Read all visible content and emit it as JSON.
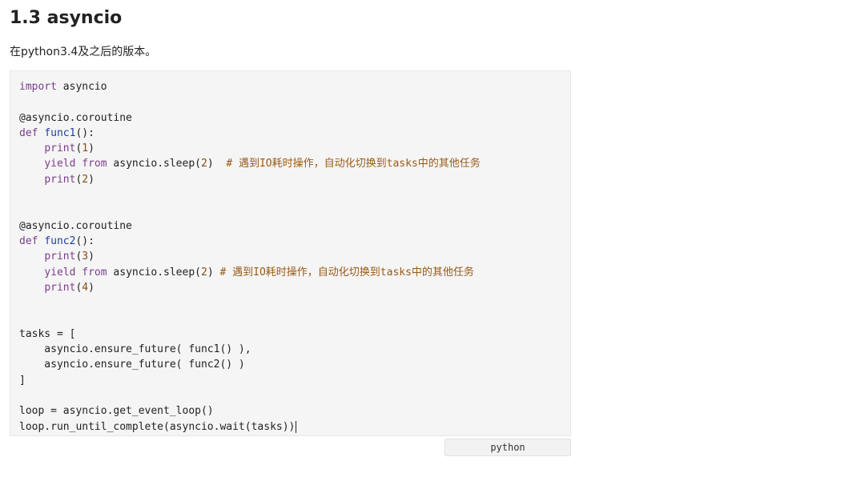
{
  "section": {
    "heading": "1.3 asyncio",
    "intro": "在python3.4及之后的版本。"
  },
  "code": {
    "language_label": "python",
    "lines": [
      [
        {
          "text": "import",
          "type": "keyword"
        },
        {
          "text": " asyncio",
          "type": "plain"
        }
      ],
      [],
      [
        {
          "text": "@asyncio.coroutine",
          "type": "plain"
        }
      ],
      [
        {
          "text": "def",
          "type": "keyword"
        },
        {
          "text": " ",
          "type": "plain"
        },
        {
          "text": "func1",
          "type": "func"
        },
        {
          "text": "():",
          "type": "plain"
        }
      ],
      [
        {
          "text": "    ",
          "type": "plain"
        },
        {
          "text": "print",
          "type": "keyword"
        },
        {
          "text": "(",
          "type": "plain"
        },
        {
          "text": "1",
          "type": "number"
        },
        {
          "text": ")",
          "type": "plain"
        }
      ],
      [
        {
          "text": "    ",
          "type": "plain"
        },
        {
          "text": "yield",
          "type": "keyword"
        },
        {
          "text": " ",
          "type": "plain"
        },
        {
          "text": "from",
          "type": "keyword"
        },
        {
          "text": " asyncio.sleep(",
          "type": "plain"
        },
        {
          "text": "2",
          "type": "number"
        },
        {
          "text": ")  ",
          "type": "plain"
        },
        {
          "text": "# 遇到IO耗时操作，自动化切换到tasks中的其他任务",
          "type": "comment"
        }
      ],
      [
        {
          "text": "    ",
          "type": "plain"
        },
        {
          "text": "print",
          "type": "keyword"
        },
        {
          "text": "(",
          "type": "plain"
        },
        {
          "text": "2",
          "type": "number"
        },
        {
          "text": ")",
          "type": "plain"
        }
      ],
      [],
      [],
      [
        {
          "text": "@asyncio.coroutine",
          "type": "plain"
        }
      ],
      [
        {
          "text": "def",
          "type": "keyword"
        },
        {
          "text": " ",
          "type": "plain"
        },
        {
          "text": "func2",
          "type": "func"
        },
        {
          "text": "():",
          "type": "plain"
        }
      ],
      [
        {
          "text": "    ",
          "type": "plain"
        },
        {
          "text": "print",
          "type": "keyword"
        },
        {
          "text": "(",
          "type": "plain"
        },
        {
          "text": "3",
          "type": "number"
        },
        {
          "text": ")",
          "type": "plain"
        }
      ],
      [
        {
          "text": "    ",
          "type": "plain"
        },
        {
          "text": "yield",
          "type": "keyword"
        },
        {
          "text": " ",
          "type": "plain"
        },
        {
          "text": "from",
          "type": "keyword"
        },
        {
          "text": " asyncio.sleep(",
          "type": "plain"
        },
        {
          "text": "2",
          "type": "number"
        },
        {
          "text": ") ",
          "type": "plain"
        },
        {
          "text": "# 遇到IO耗时操作，自动化切换到tasks中的其他任务",
          "type": "comment"
        }
      ],
      [
        {
          "text": "    ",
          "type": "plain"
        },
        {
          "text": "print",
          "type": "keyword"
        },
        {
          "text": "(",
          "type": "plain"
        },
        {
          "text": "4",
          "type": "number"
        },
        {
          "text": ")",
          "type": "plain"
        }
      ],
      [],
      [],
      [
        {
          "text": "tasks = [",
          "type": "plain"
        }
      ],
      [
        {
          "text": "    asyncio.ensure_future( func1() ),",
          "type": "plain"
        }
      ],
      [
        {
          "text": "    asyncio.ensure_future( func2() )",
          "type": "plain"
        }
      ],
      [
        {
          "text": "]",
          "type": "plain"
        }
      ],
      [],
      [
        {
          "text": "loop = asyncio.get_event_loop()",
          "type": "plain"
        }
      ],
      [
        {
          "text": "loop.run_until_complete(asyncio.wait(tasks))",
          "type": "plain"
        }
      ]
    ]
  }
}
